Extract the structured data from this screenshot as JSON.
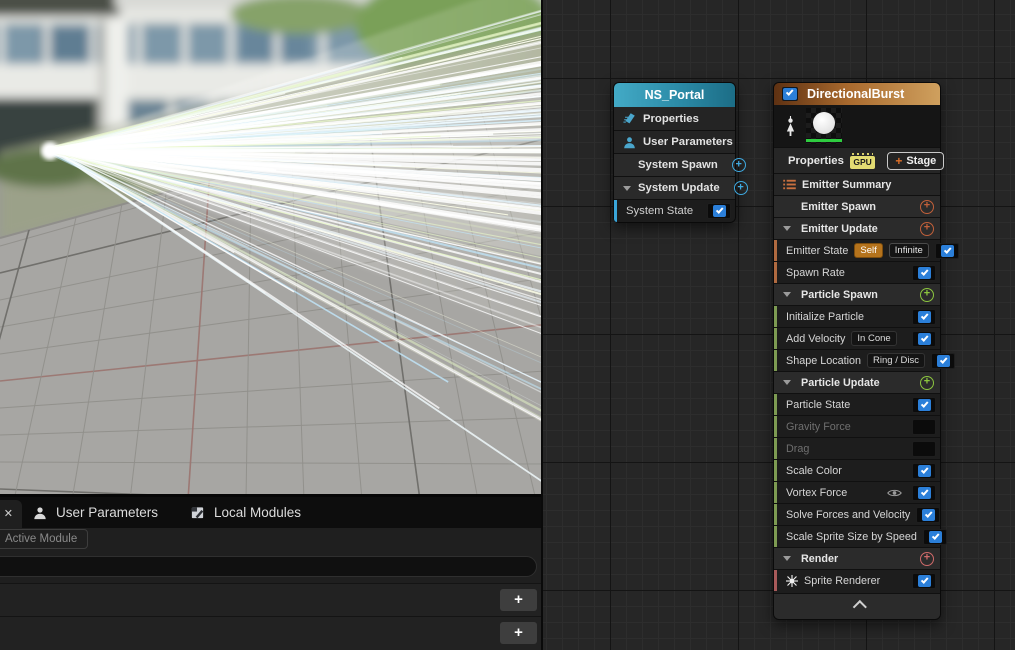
{
  "ui": {
    "plus": "+",
    "close": "✕"
  },
  "colors": {
    "accent_blue": "#2b7fd9",
    "system_header_teal": "#2b8aa6",
    "emitter_header_orange": "#a96a2e",
    "emitter_strip_orange": "#b06a40",
    "particle_strip_green": "#7d9b52",
    "render_strip_red": "#a85a5a",
    "gpu_badge_yellow": "#e3dc72",
    "self_badge_amber": "#b5731c",
    "thumbnail_bar_green": "#2ecc40"
  },
  "tabs": {
    "items": [
      {
        "label": "User Parameters"
      },
      {
        "label": "Local Modules"
      }
    ]
  },
  "module_panel": {
    "filter_label": "Active Module",
    "add_button": "+"
  },
  "system_node": {
    "title": "NS_Portal",
    "rows": [
      {
        "label": "Properties"
      },
      {
        "label": "User Parameters"
      },
      {
        "label": "System Spawn"
      },
      {
        "label": "System Update"
      },
      {
        "label": "System State",
        "checked": true
      }
    ]
  },
  "emitter_node": {
    "title": "DirectionalBurst",
    "enabled": true,
    "properties_label": "Properties",
    "gpu_badge": "GPU",
    "stage_button": "Stage",
    "rows": [
      {
        "label": "Emitter Summary"
      },
      {
        "label": "Emitter Spawn"
      },
      {
        "label": "Emitter Update"
      },
      {
        "label": "Emitter State",
        "badges": [
          "Self",
          "Infinite"
        ],
        "checked": true
      },
      {
        "label": "Spawn Rate",
        "checked": true
      },
      {
        "label": "Particle Spawn"
      },
      {
        "label": "Initialize Particle",
        "checked": true
      },
      {
        "label": "Add Velocity",
        "badges": [
          "In Cone"
        ],
        "checked": true
      },
      {
        "label": "Shape Location",
        "badges": [
          "Ring / Disc"
        ],
        "checked": true
      },
      {
        "label": "Particle Update"
      },
      {
        "label": "Particle State",
        "checked": true
      },
      {
        "label": "Gravity Force",
        "checked": false
      },
      {
        "label": "Drag",
        "checked": false
      },
      {
        "label": "Scale Color",
        "checked": true
      },
      {
        "label": "Vortex Force",
        "checked": true
      },
      {
        "label": "Solve Forces and Velocity",
        "checked": true
      },
      {
        "label": "Scale Sprite Size by Speed",
        "checked": true
      },
      {
        "label": "Render"
      },
      {
        "label": "Sprite Renderer",
        "checked": true
      }
    ]
  }
}
